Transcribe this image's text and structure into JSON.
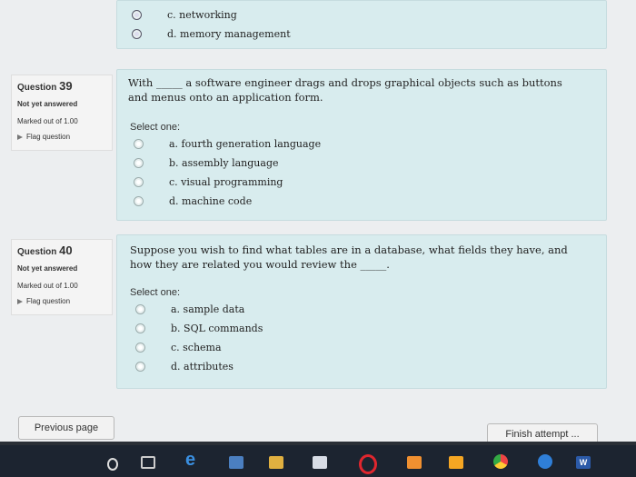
{
  "top": {
    "options": [
      "c. networking",
      "d. memory management"
    ]
  },
  "q39": {
    "label": "Question",
    "number": "39",
    "state": "Not yet answered",
    "marks": "Marked out of 1.00",
    "flag": "Flag question",
    "text_line1": "With _____ a software engineer drags and drops graphical objects such as buttons",
    "text_line2": "and menus onto an application form.",
    "prompt": "Select one:",
    "options": [
      "a. fourth generation language",
      "b. assembly language",
      "c. visual programming",
      "d. machine code"
    ]
  },
  "q40": {
    "label": "Question",
    "number": "40",
    "state": "Not yet answered",
    "marks": "Marked out of 1.00",
    "flag": "Flag question",
    "text_line1": "Suppose you wish to find what tables are in a database, what fields they have, and",
    "text_line2": "how they are related you would review the _____.",
    "prompt": "Select one:",
    "options": [
      "a. sample data",
      "b. SQL commands",
      "c. schema",
      "d. attributes"
    ]
  },
  "nav": {
    "previous": "Previous page",
    "finish": "Finish attempt ..."
  },
  "taskbar": {
    "icons": [
      "search-icon",
      "task-view-icon",
      "edge-icon",
      "store-icon",
      "mail-icon",
      "opera-icon",
      "file-icon",
      "chrome-icon",
      "cortana-icon",
      "word-icon"
    ]
  }
}
